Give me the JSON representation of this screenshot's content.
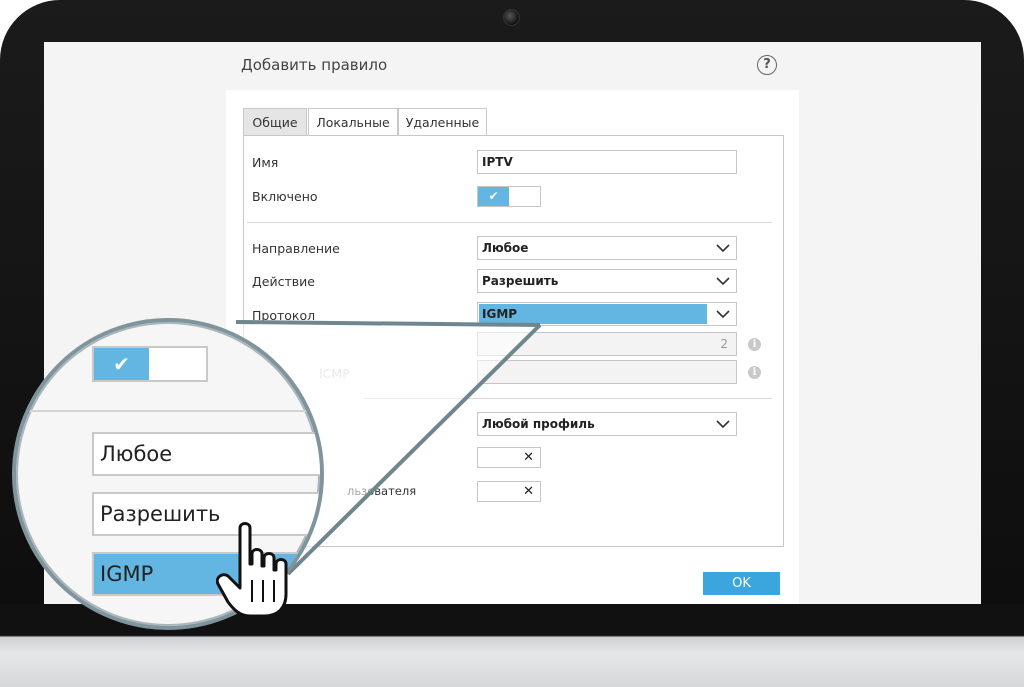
{
  "dialog": {
    "title": "Добавить правило",
    "help_glyph": "?",
    "ok_label": "OK"
  },
  "tabs": [
    {
      "label": "Общие",
      "active": true
    },
    {
      "label": "Локальные",
      "active": false
    },
    {
      "label": "Удаленные",
      "active": false
    }
  ],
  "form": {
    "name": {
      "label": "Имя",
      "value": "IPTV"
    },
    "enabled": {
      "label": "Включено",
      "state": "on"
    },
    "direction": {
      "label": "Направление",
      "value": "Любое"
    },
    "action": {
      "label": "Действие",
      "value": "Разрешить"
    },
    "protocol": {
      "label": "Протокол",
      "value": "IGMP"
    },
    "ip_number": {
      "value": "2"
    },
    "icmp": {
      "label_fragment": "ICMP"
    },
    "profile": {
      "value": "Любой профиль"
    },
    "user_fragment": {
      "label": "льзователя"
    }
  },
  "magnifier": {
    "direction_value": "Любое",
    "action_value": "Разрешить",
    "protocol_value": "IGMP"
  },
  "colors": {
    "accent": "#63b6e2",
    "ok_button": "#3ba6de",
    "callout_border": "#6f868e"
  },
  "icons": {
    "check": "✔",
    "close": "✕",
    "info": "i"
  }
}
